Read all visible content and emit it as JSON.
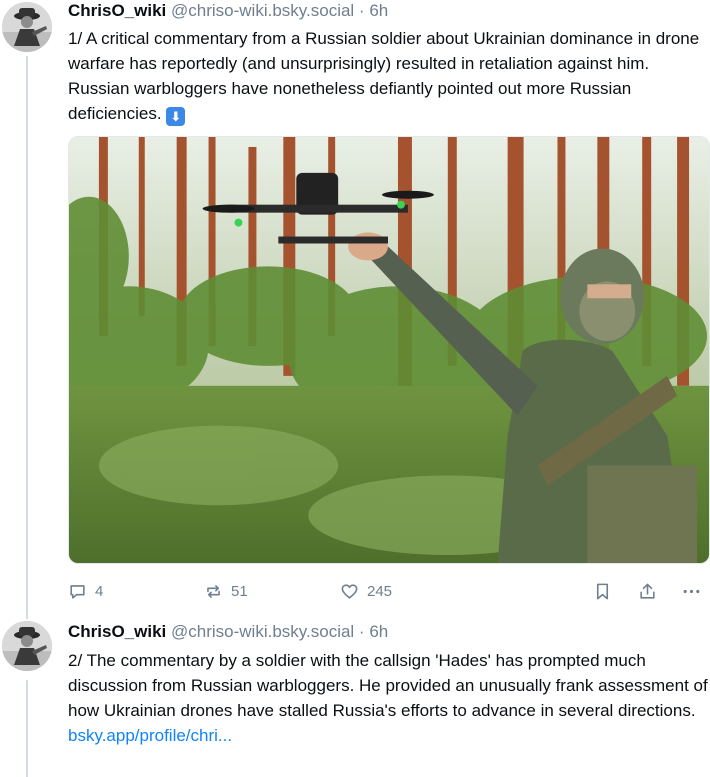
{
  "posts": [
    {
      "author": {
        "display_name": "ChrisO_wiki",
        "handle": "@chriso-wiki.bsky.social",
        "time_sep": " · ",
        "time": "6h"
      },
      "text": "1/ A critical commentary from a Russian soldier about Ukrainian dominance in drone warfare has reportedly (and unsurprisingly) resulted in retaliation against him. Russian warbloggers have nonetheless defiantly pointed out more Russian deficiencies.",
      "emoji": "⬇",
      "actions": {
        "reply_count": "4",
        "repost_count": "51",
        "like_count": "245"
      }
    },
    {
      "author": {
        "display_name": "ChrisO_wiki",
        "handle": "@chriso-wiki.bsky.social",
        "time_sep": " · ",
        "time": "6h"
      },
      "text": "2/ The commentary by a soldier with the callsign 'Hades' has prompted much discussion from Russian warbloggers. He provided an unusually frank assessment of how Ukrainian drones have stalled Russia's efforts to advance in several directions.",
      "link_text": "bsky.app/profile/chri..."
    }
  ],
  "icons": {
    "reply": "reply-icon",
    "repost": "repost-icon",
    "like": "heart-icon",
    "bookmark": "bookmark-icon",
    "share": "share-icon",
    "more": "more-icon"
  },
  "colors": {
    "text": "#0b0f14",
    "muted": "#6f7f8f",
    "link": "#1083fe",
    "thread_line": "#d4dbe2"
  }
}
